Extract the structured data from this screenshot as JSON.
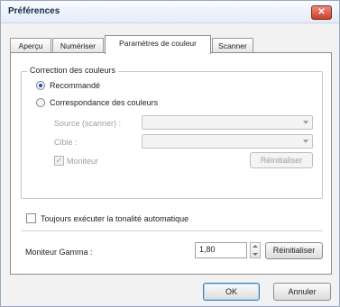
{
  "window": {
    "title": "Préférences",
    "close_glyph": "✕"
  },
  "tabs": [
    {
      "label": "Aperçu",
      "active": false
    },
    {
      "label": "Numériser",
      "active": false
    },
    {
      "label": "Paramètres de couleur",
      "active": true
    },
    {
      "label": "Scanner",
      "active": false
    }
  ],
  "color_correction": {
    "group_title": "Correction des couleurs",
    "recommended_label": "Recommandé",
    "recommended_selected": true,
    "matching_label": "Correspondance des couleurs",
    "matching_selected": false,
    "source_label": "Source (scanner) :",
    "source_value": "",
    "target_label": "Cible :",
    "target_value": "",
    "monitor_label": "Moniteur",
    "monitor_checked": true,
    "reset_label": "Réinitialiser"
  },
  "auto_tone": {
    "label": "Toujours exécuter la tonalité automatique",
    "checked": false
  },
  "gamma": {
    "label": "Moniteur Gamma :",
    "value": "1,80",
    "reset_label": "Réinitialiser"
  },
  "footer": {
    "ok_label": "OK",
    "cancel_label": "Annuler"
  },
  "colors": {
    "accent": "#1f4fa7",
    "close_button": "#c7412c"
  }
}
